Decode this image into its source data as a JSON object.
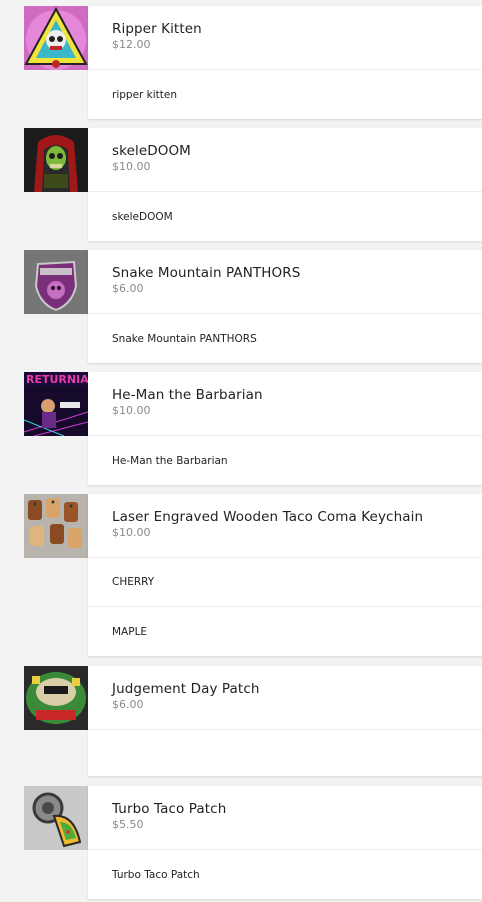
{
  "products": [
    {
      "title": "Ripper Kitten",
      "price": "$12.00",
      "image": "ripper-kitten-patch",
      "variants": [
        "ripper kitten"
      ]
    },
    {
      "title": "skeleDOOM",
      "price": "$10.00",
      "image": "skeledoom-pin",
      "variants": [
        "skeleDOOM"
      ]
    },
    {
      "title": "Snake Mountain PANTHORS",
      "price": "$6.00",
      "image": "panthors-patch",
      "variants": [
        "Snake Mountain PANTHORS"
      ]
    },
    {
      "title": "He-Man the Barbarian",
      "price": "$10.00",
      "image": "returnia-print",
      "thumb_text": "RETURNIA",
      "variants": [
        "He-Man the Barbarian"
      ]
    },
    {
      "title": "Laser Engraved Wooden Taco Coma Keychain",
      "price": "$10.00",
      "image": "wooden-keychains",
      "variants": [
        "CHERRY",
        "MAPLE"
      ]
    },
    {
      "title": "Judgement Day Patch",
      "price": "$6.00",
      "image": "judgement-day-patch",
      "variants": [
        ""
      ]
    },
    {
      "title": "Turbo Taco Patch",
      "price": "$5.50",
      "image": "turbo-taco-patch",
      "variants": [
        "Turbo Taco Patch"
      ]
    }
  ],
  "colors": {
    "background": "#f3f3f3",
    "card": "#ffffff",
    "title_text": "#222222",
    "price_text": "#8a8a8a"
  }
}
